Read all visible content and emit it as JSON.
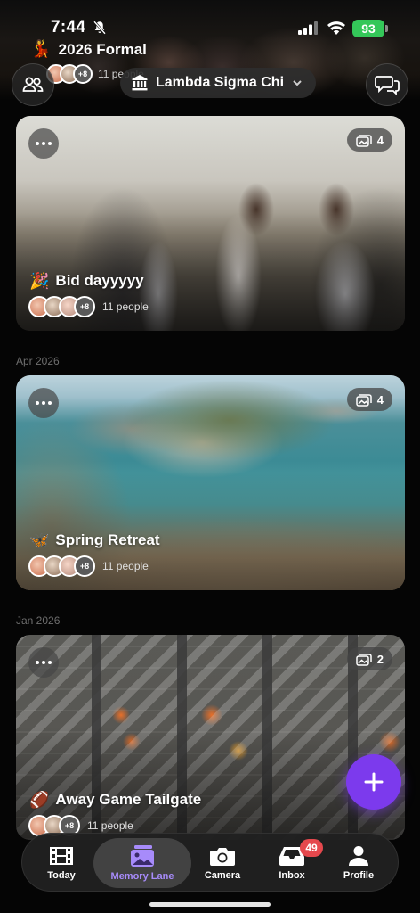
{
  "status_bar": {
    "time": "7:44",
    "battery": "93"
  },
  "header": {
    "event_emoji": "💃",
    "event_title": "2026 Formal",
    "avatar_extra": "+8",
    "people": "11 people",
    "org_name": "Lambda Sigma Chi"
  },
  "feed": {
    "cards": [
      {
        "emoji": "🎉",
        "title": "Bid dayyyyy",
        "photo_count": "4",
        "avatar_extra": "+8",
        "people": "11 people"
      },
      {
        "month": "Apr 2026",
        "emoji": "🦋",
        "title": "Spring Retreat",
        "photo_count": "4",
        "avatar_extra": "+8",
        "people": "11 people"
      },
      {
        "month": "Jan 2026",
        "emoji": "🏈",
        "title": "Away Game Tailgate",
        "photo_count": "2",
        "avatar_extra": "+8",
        "people": "11 people"
      }
    ]
  },
  "tab_bar": {
    "tabs": [
      {
        "label": "Today",
        "icon": "film-icon"
      },
      {
        "label": "Memory Lane",
        "icon": "photos-icon",
        "active": true
      },
      {
        "label": "Camera",
        "icon": "camera-icon"
      },
      {
        "label": "Inbox",
        "icon": "inbox-icon",
        "badge": "49"
      },
      {
        "label": "Profile",
        "icon": "person-icon"
      }
    ]
  },
  "colors": {
    "accent": "#7c3aed",
    "active_tab_text": "#a78bfa",
    "badge": "#e5484d",
    "battery": "#34c759"
  }
}
